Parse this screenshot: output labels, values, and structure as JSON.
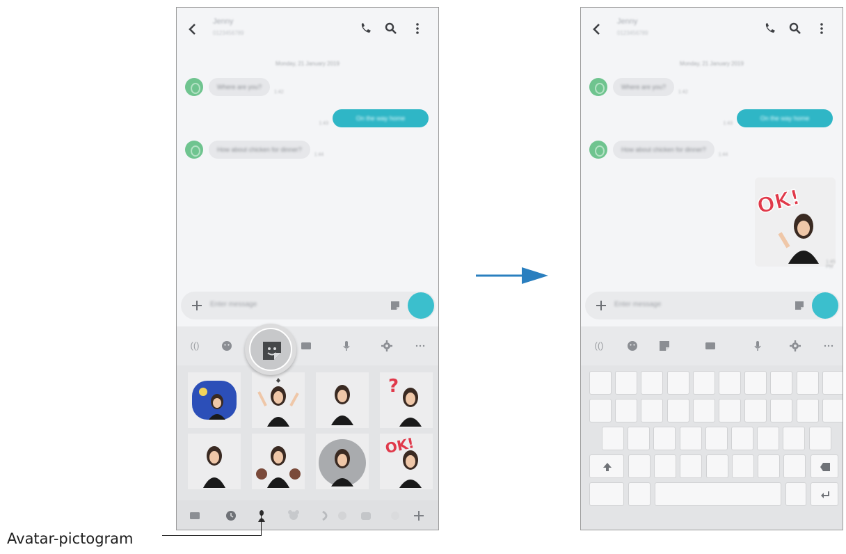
{
  "left": {
    "header": {
      "contact_name": "Jenny",
      "contact_sub": "0123456789"
    },
    "date": "Monday, 21 January 2019",
    "messages": {
      "m1": {
        "text": "Where are you?",
        "time": "1:42"
      },
      "m2": {
        "text": "On the way home",
        "time": "1:43"
      },
      "m3": {
        "text": "How about chicken for dinner?",
        "time": "1:44"
      }
    },
    "input_placeholder": "Enter message",
    "toolbar_ai": "(()"
  },
  "right": {
    "header": {
      "contact_name": "Jenny",
      "contact_sub": "0123456789"
    },
    "date": "Monday, 21 January 2019",
    "messages": {
      "m1": {
        "text": "Where are you?",
        "time": "1:42"
      },
      "m2": {
        "text": "On the way home",
        "time": "1:43"
      },
      "m3": {
        "text": "How about chicken for dinner?",
        "time": "1:44"
      }
    },
    "sticker_time": "1:45 PM",
    "input_placeholder": "Enter message",
    "toolbar_ai": "(()"
  },
  "callout": {
    "label": "Avatar-pictogram"
  },
  "colors": {
    "accent": "#2fb6c6",
    "avatar_green": "#6fc48f",
    "arrow": "#2a7fbf",
    "sticker_red": "#e0394a"
  },
  "icons": [
    "back-icon",
    "call-icon",
    "search-icon",
    "more-icon",
    "plus-icon",
    "sticker-icon",
    "emoji-icon",
    "gif-icon",
    "mic-icon",
    "settings-icon",
    "shift-icon",
    "backspace-icon",
    "enter-icon",
    "arrow-right-icon"
  ]
}
